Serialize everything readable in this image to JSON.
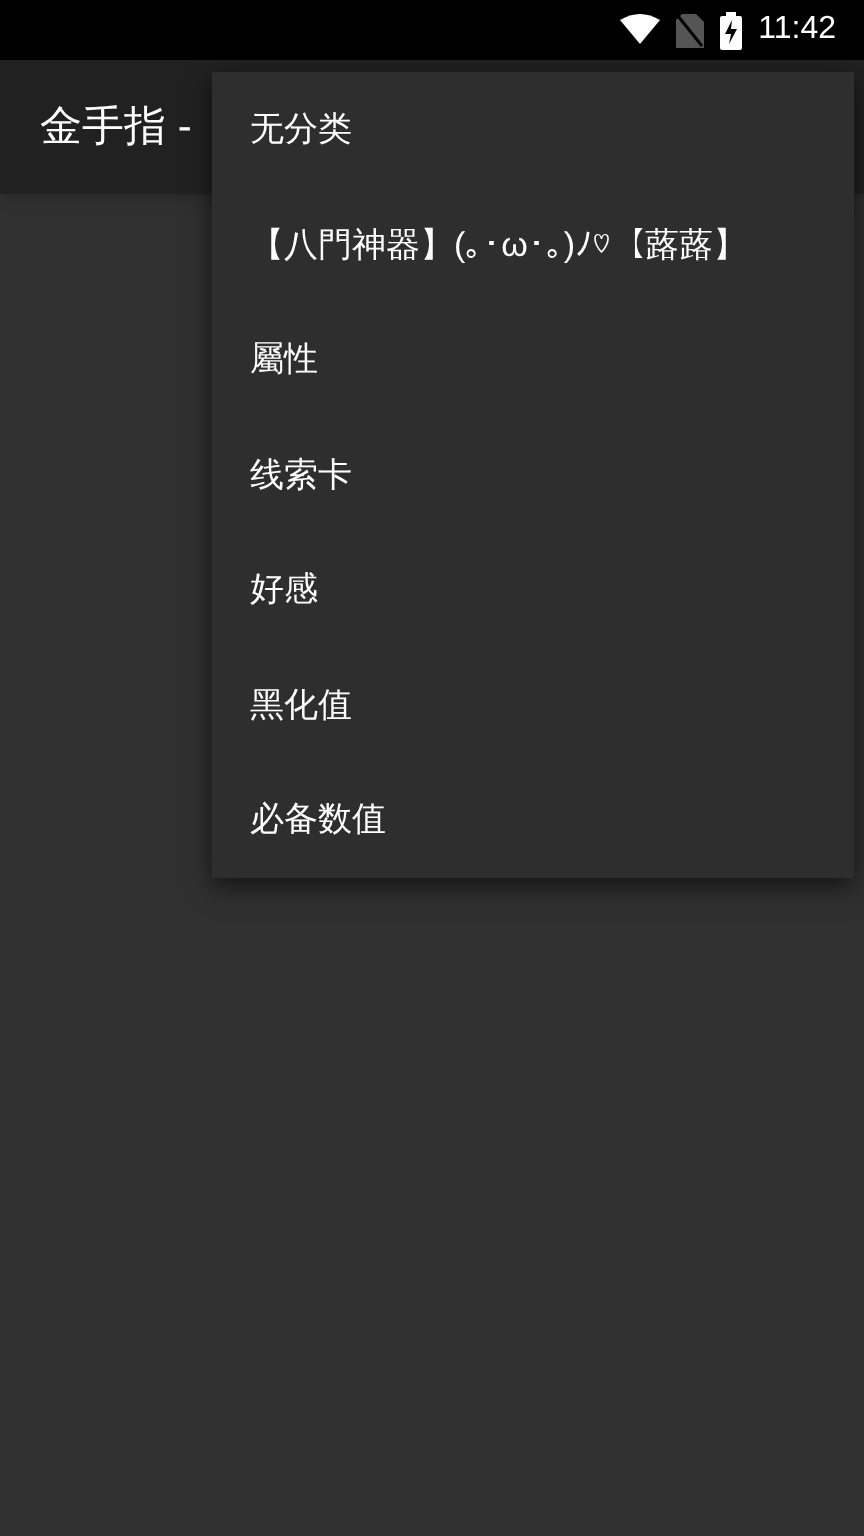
{
  "status_bar": {
    "time": "11:42"
  },
  "app_bar": {
    "title": "金手指 -"
  },
  "menu": {
    "items": [
      {
        "label": "无分类"
      },
      {
        "label": "【八門神器】(｡･ω･｡)ﾉ♡【蕗蕗】"
      },
      {
        "label": "屬性"
      },
      {
        "label": "线索卡"
      },
      {
        "label": "好感"
      },
      {
        "label": "黑化值"
      },
      {
        "label": "必备数值"
      }
    ]
  }
}
